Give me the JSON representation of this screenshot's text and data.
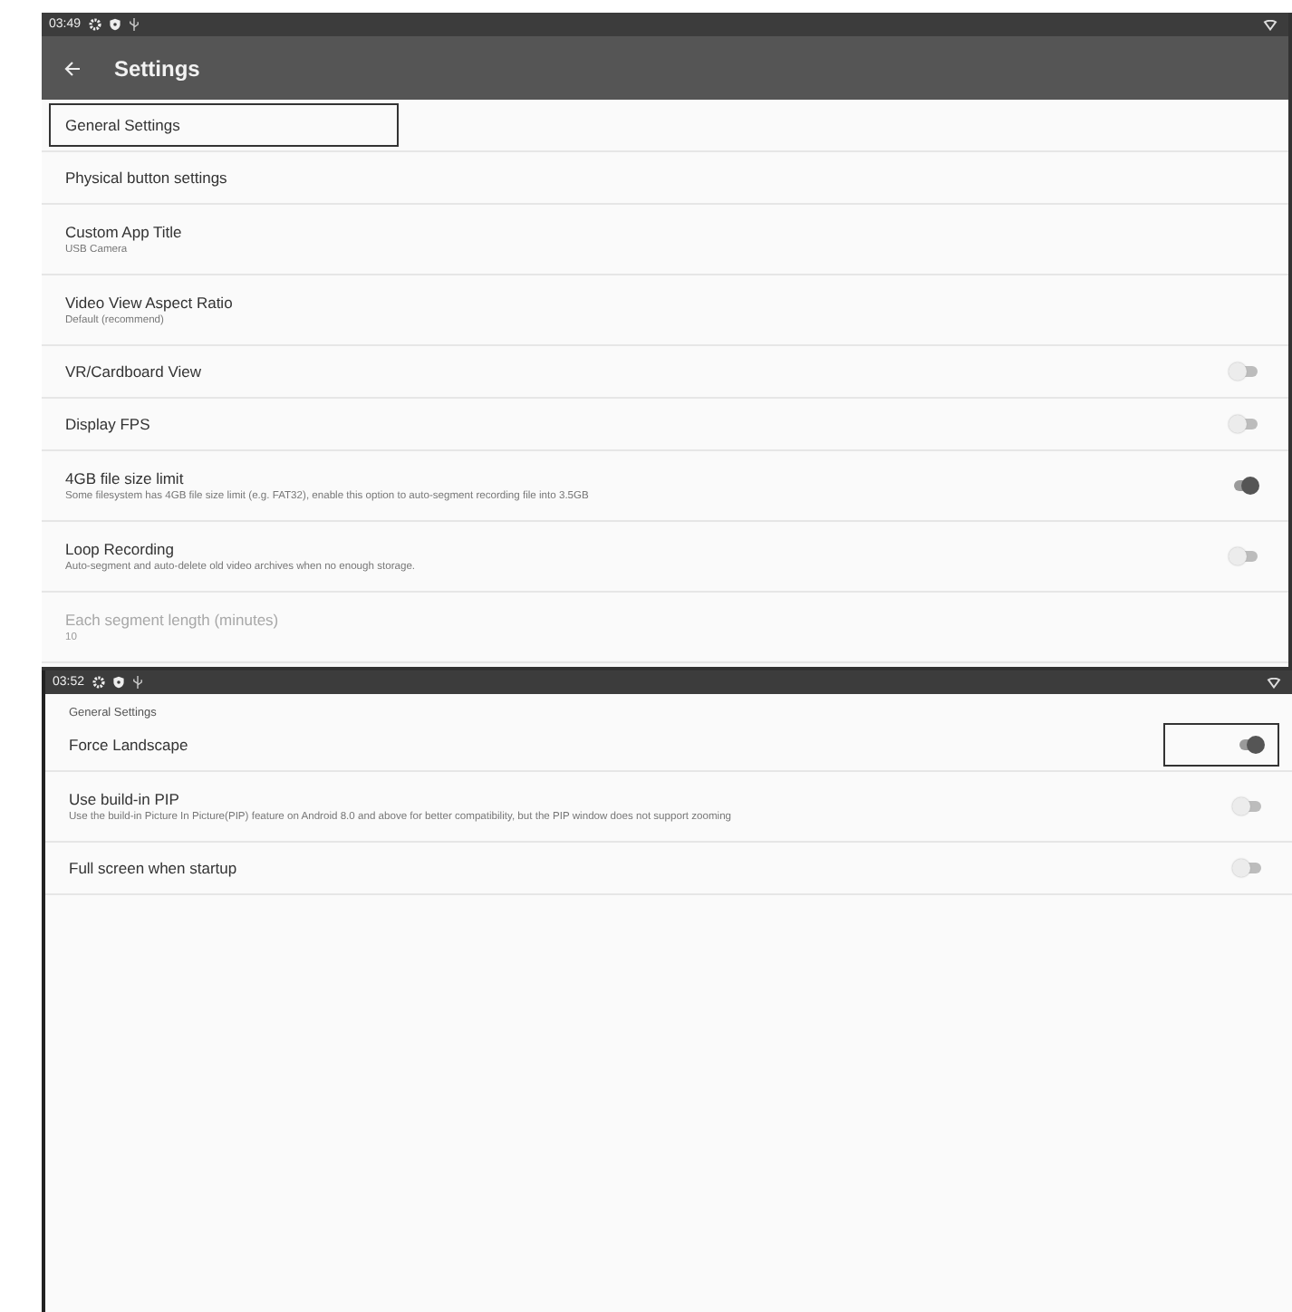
{
  "screens": [
    {
      "status_bar": {
        "time": "03:49"
      },
      "toolbar": {
        "title": "Settings"
      },
      "items": [
        {
          "kind": "plain",
          "title": "General Settings",
          "focused": true,
          "disabled": false
        },
        {
          "kind": "plain",
          "title": "Physical button settings",
          "focused": false,
          "disabled": false
        },
        {
          "kind": "plain",
          "title": "Custom App Title",
          "summary": "USB Camera",
          "focused": false,
          "disabled": false
        },
        {
          "kind": "plain",
          "title": "Video View Aspect Ratio",
          "summary": "Default (recommend)",
          "focused": false,
          "disabled": false
        },
        {
          "kind": "switch",
          "title": "VR/Cardboard View",
          "on": false,
          "focused": false,
          "disabled": false
        },
        {
          "kind": "switch",
          "title": "Display FPS",
          "on": false,
          "focused": false,
          "disabled": false
        },
        {
          "kind": "switch",
          "title": "4GB file size limit",
          "summary": "Some filesystem has 4GB file size limit (e.g. FAT32), enable this option to auto-segment recording file into 3.5GB",
          "on": true,
          "focused": false,
          "disabled": false
        },
        {
          "kind": "switch",
          "title": "Loop Recording",
          "summary": "Auto-segment and auto-delete old video archives when no enough storage.",
          "on": false,
          "focused": false,
          "disabled": false
        },
        {
          "kind": "plain",
          "title": "Each segment length (minutes)",
          "summary": "10",
          "focused": false,
          "disabled": true
        }
      ]
    },
    {
      "status_bar": {
        "time": "03:52"
      },
      "category": "General Settings",
      "items": [
        {
          "kind": "switch",
          "title": "Force Landscape",
          "on": true,
          "focused": true,
          "disabled": false
        },
        {
          "kind": "switch",
          "title": "Use build-in PIP",
          "summary": "Use the build-in Picture In Picture(PIP) feature on Android 8.0 and above for better compatibility, but the PIP window does not support zooming",
          "on": false,
          "focused": false,
          "disabled": false
        },
        {
          "kind": "switch",
          "title": "Full screen when startup",
          "on": false,
          "focused": false,
          "disabled": false
        }
      ]
    }
  ]
}
